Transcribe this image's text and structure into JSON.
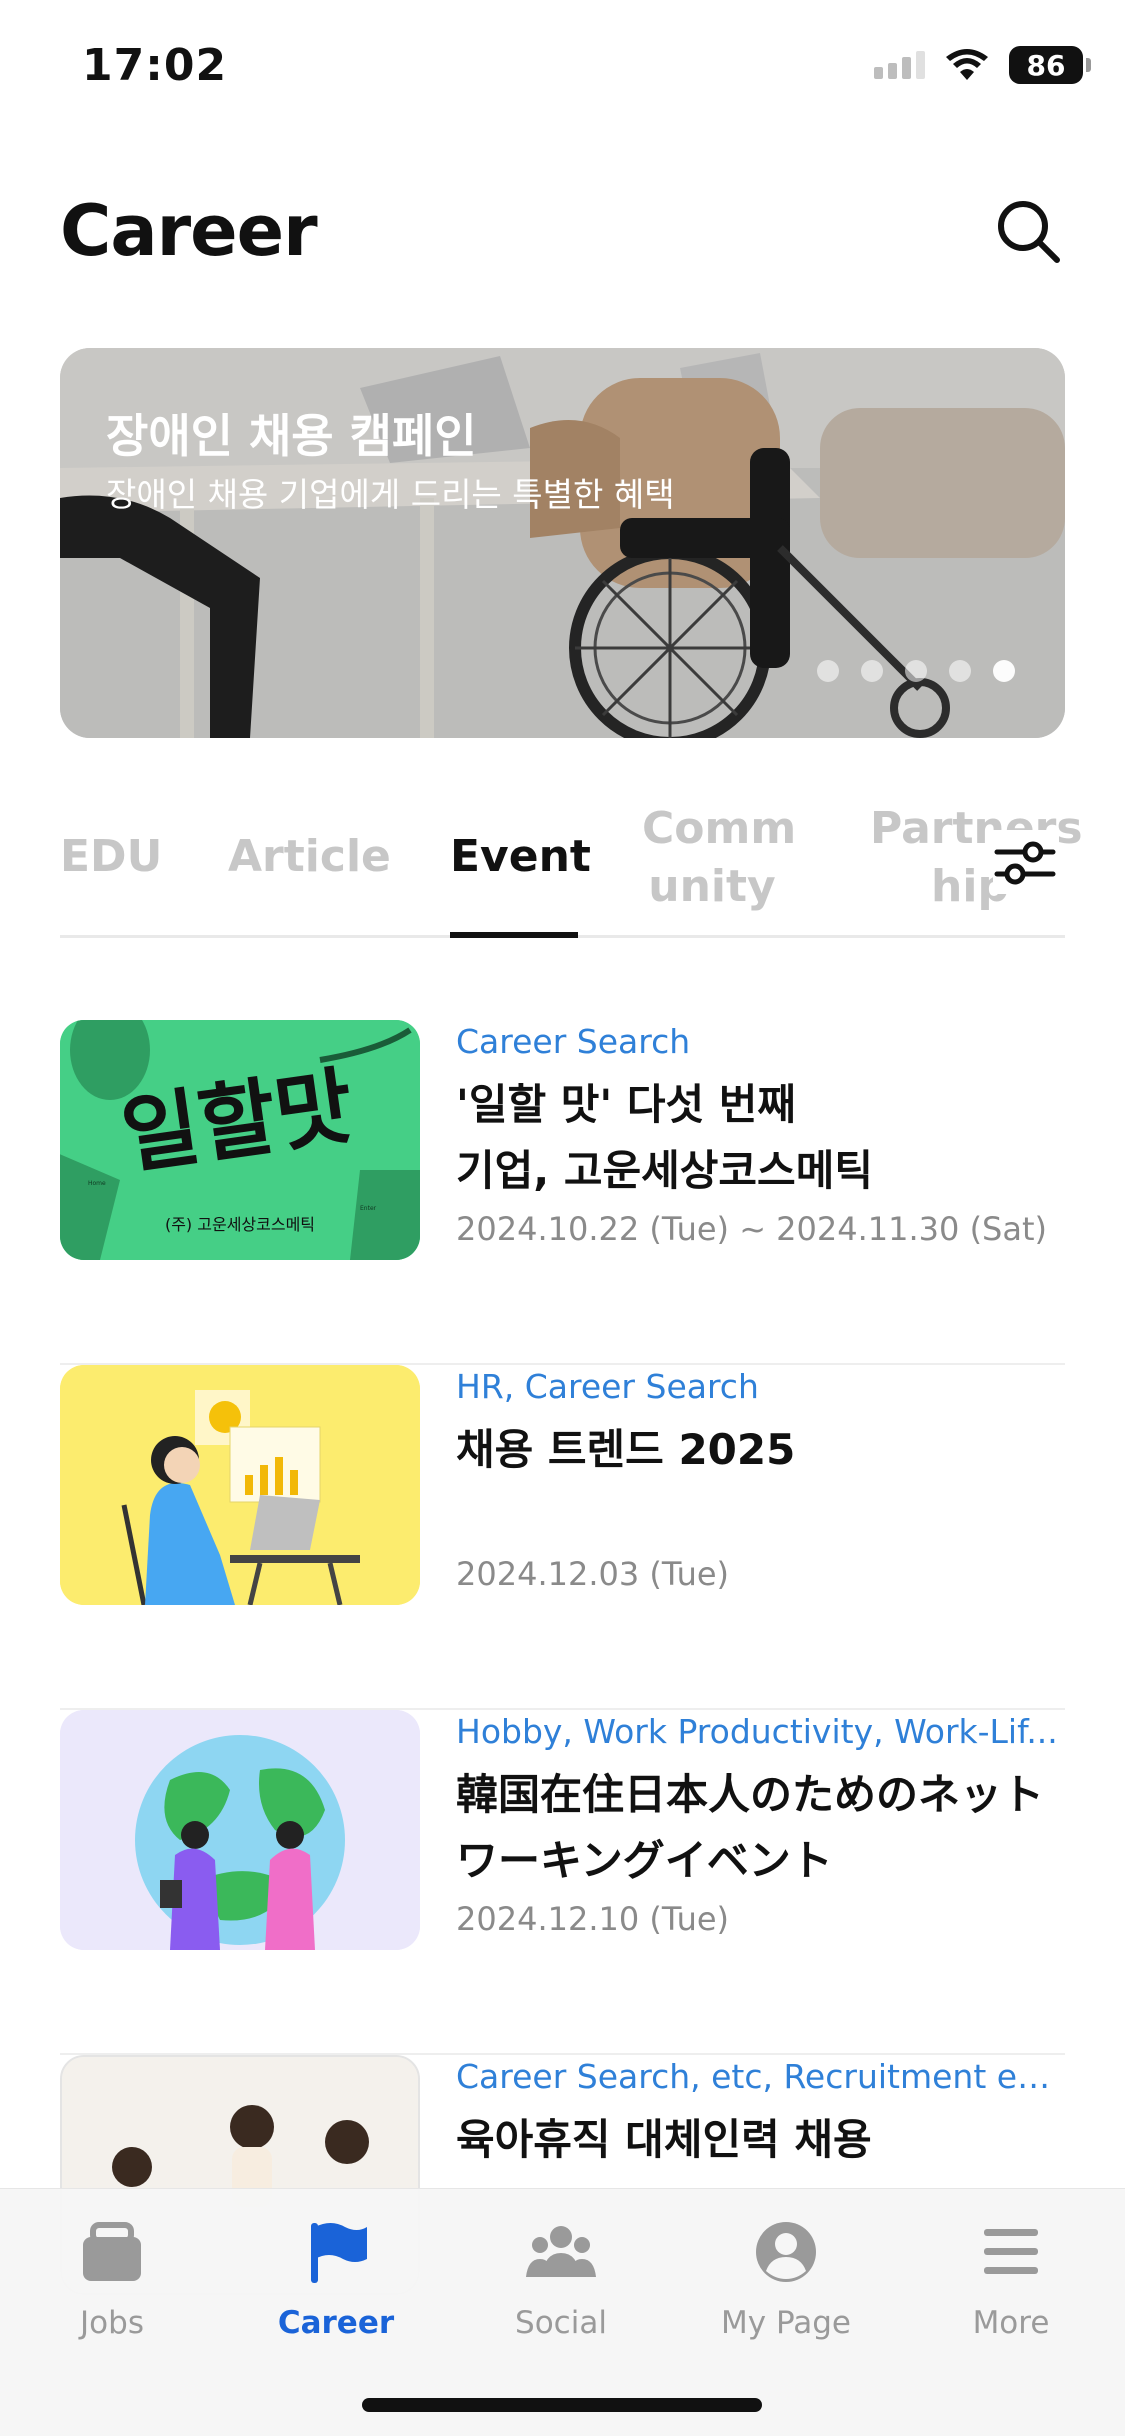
{
  "status_bar": {
    "time": "17:02",
    "battery": "86"
  },
  "header": {
    "title": "Career"
  },
  "banner": {
    "title": "장애인 채용 캠페인",
    "subtitle": "장애인 채용 기업에게 드리는 특별한 혜택",
    "dot_count": 5,
    "active_dot": 0
  },
  "tabs": [
    {
      "label": "EDU"
    },
    {
      "label": "Article"
    },
    {
      "label": "Event",
      "active": true
    },
    {
      "label": "Comm\nunity"
    },
    {
      "label": "Partners\nhip"
    }
  ],
  "items": [
    {
      "category": "Career Search",
      "title": "'일할 맛' 다섯 번째\n기업, 고운세상코스메틱",
      "date": "2024.10.22 (Tue) ~ 2024.11.30 (Sat)",
      "thumb_text": "일할맛",
      "thumb_caption": "(주) 고운세상코스메틱",
      "thumb_keys": [
        "Home",
        "Enter"
      ]
    },
    {
      "category": "HR, Career Search",
      "title": "채용 트렌드 2025",
      "date": "2024.12.03 (Tue)"
    },
    {
      "category": "Hobby, Work Productivity, Work-Lif...",
      "title": "韓国在住日本人のためのネット\nワーキングイベント",
      "date": "2024.12.10 (Tue)"
    },
    {
      "category": "Career Search, etc, Recruitment event",
      "title": "육아휴직 대체인력 채용",
      "date": ""
    }
  ],
  "bottom_nav": [
    {
      "label": "Jobs",
      "icon": "briefcase-icon"
    },
    {
      "label": "Career",
      "icon": "flag-icon",
      "active": true
    },
    {
      "label": "Social",
      "icon": "people-icon"
    },
    {
      "label": "My Page",
      "icon": "person-circle-icon"
    },
    {
      "label": "More",
      "icon": "menu-icon"
    }
  ],
  "colors": {
    "accent": "#1a63d8",
    "category": "#2f80d8",
    "date": "#8a8a8a"
  }
}
